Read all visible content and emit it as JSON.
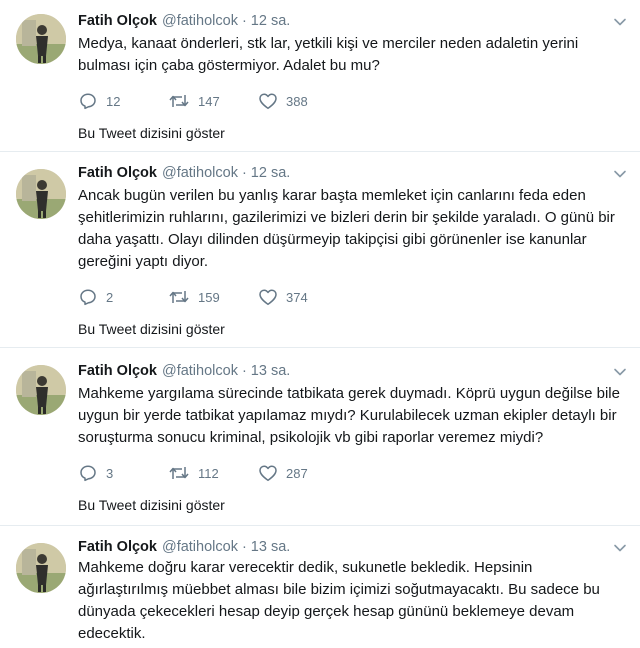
{
  "tweets": [
    {
      "name": "Fatih Olçok",
      "handle": "@fatiholcok",
      "time": "12 sa.",
      "text": "Medya, kanaat önderleri, stk lar, yetkili kişi ve merciler neden adaletin yerini\nbulması için çaba göstermiyor. Adalet bu mu?",
      "replies": "12",
      "retweets": "147",
      "likes": "388",
      "thread_link": "Bu Tweet dizisini göster"
    },
    {
      "name": "Fatih Olçok",
      "handle": "@fatiholcok",
      "time": "12 sa.",
      "text": "Ancak bugün verilen bu yanlış karar başta memleket için canlarını feda eden\nşehitlerimizin ruhlarını, gazilerimizi ve bizleri derin bir şekilde yaraladı. O günü bir\ndaha yaşattı. Olayı dilinden düşürmeyip takipçisi gibi görünenler ise kanunlar\ngereğini yaptı diyor.",
      "replies": "2",
      "retweets": "159",
      "likes": "374",
      "thread_link": "Bu Tweet dizisini göster"
    },
    {
      "name": "Fatih Olçok",
      "handle": "@fatiholcok",
      "time": "13 sa.",
      "text": "Mahkeme yargılama sürecinde tatbikata gerek duymadı. Köprü uygun değilse bile\nuygun bir yerde tatbikat yapılamaz mıydı? Kurulabilecek uzman ekipler detaylı bir\nsoruşturma sonucu kriminal, psikolojik vb gibi raporlar veremez miydi?",
      "replies": "3",
      "retweets": "112",
      "likes": "287",
      "thread_link": "Bu Tweet dizisini göster"
    },
    {
      "name": "Fatih Olçok",
      "handle": "@fatiholcok",
      "time": "13 sa.",
      "text": "Mahkeme doğru karar verecektir dedik, sukunetle bekledik. Hepsinin\nağırlaştırılmış müebbet alması bile bizim içimizi soğutmayacaktı. Bu sadece bu\ndünyada çekecekleri hesap deyip gerçek hesap gününü beklemeye devam\nedecektik."
    }
  ],
  "icons": {
    "reply": "reply-icon",
    "retweet": "retweet-icon",
    "like": "heart-icon",
    "caret": "chevron-down-icon"
  },
  "colors": {
    "text": "#14171a",
    "secondary": "#657786",
    "separator": "#e6ecf0"
  }
}
